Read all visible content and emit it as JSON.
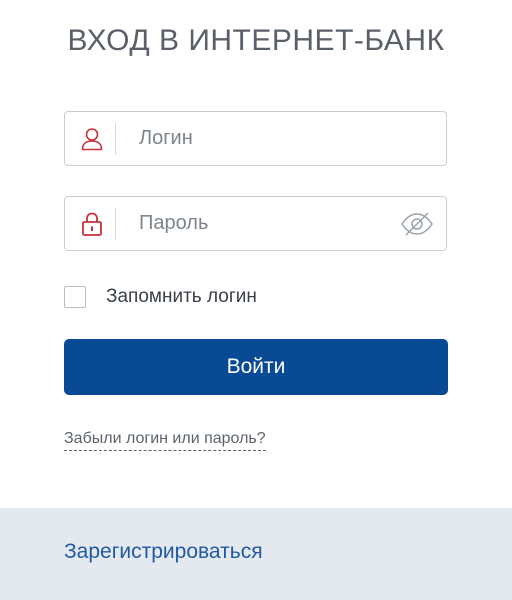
{
  "page": {
    "title": "ВХОД В ИНТЕРНЕТ-БАНК"
  },
  "colors": {
    "icon_red": "#c8313a",
    "button_blue": "#094a95",
    "link_blue": "#1f5aa3",
    "footer_bg": "#e4e8ef"
  },
  "login_field": {
    "placeholder": "Логин",
    "value": "",
    "icon": "user-icon"
  },
  "password_field": {
    "placeholder": "Пароль",
    "value": "",
    "icon": "lock-icon",
    "toggle_icon": "eye-crossed-icon"
  },
  "remember": {
    "label": "Запомнить логин",
    "checked": false
  },
  "submit": {
    "label": "Войти"
  },
  "forgot": {
    "label": "Забыли логин или пароль?"
  },
  "footer": {
    "register_label": "Зарегистрироваться"
  }
}
